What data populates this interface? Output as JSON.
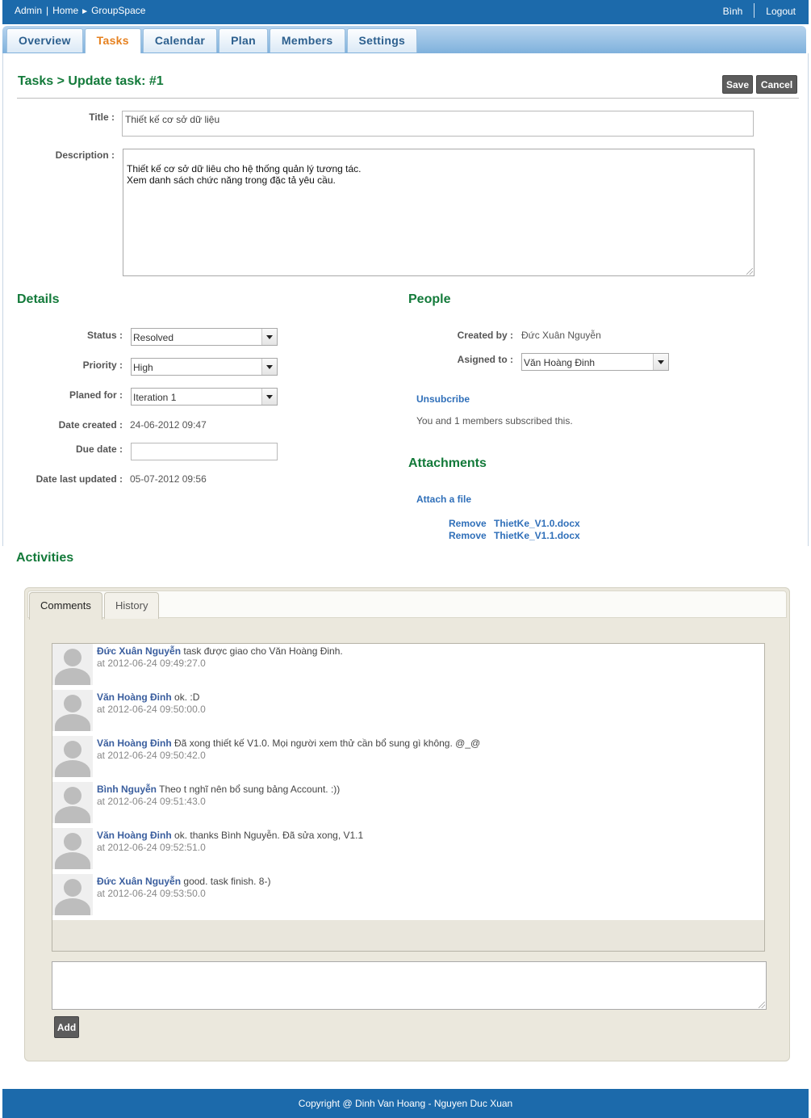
{
  "topbar": {
    "crumbs": [
      "Admin",
      "Home",
      "GroupSpace"
    ],
    "crumb_sep": "|",
    "crumb_arrow": "►",
    "user": "Bình",
    "logout": "Logout"
  },
  "tabs": [
    {
      "label": "Overview",
      "active": false
    },
    {
      "label": "Tasks",
      "active": true
    },
    {
      "label": "Calendar",
      "active": false
    },
    {
      "label": "Plan",
      "active": false
    },
    {
      "label": "Members",
      "active": false
    },
    {
      "label": "Settings",
      "active": false
    }
  ],
  "heading": "Tasks > Update task: #1",
  "buttons": {
    "save": "Save",
    "cancel": "Cancel",
    "add": "Add"
  },
  "form": {
    "title_label": "Title :",
    "title_value": "Thiết kế cơ sở dữ liệu",
    "description_label": "Description :",
    "description_value": "Thiết kế cơ sở dữ liêu cho hệ thống quản lý tương tác.\nXem danh sách chức năng trong đặc tả yêu cầu."
  },
  "details": {
    "section_title": "Details",
    "status_label": "Status :",
    "status_value": "Resolved",
    "priority_label": "Priority :",
    "priority_value": "High",
    "planed_label": "Planed for :",
    "planed_value": "Iteration 1",
    "created_label": "Date created :",
    "created_value": "24-06-2012 09:47",
    "due_label": "Due date :",
    "due_value": "",
    "updated_label": "Date last updated :",
    "updated_value": "05-07-2012 09:56"
  },
  "people": {
    "section_title": "People",
    "created_by_label": "Created by :",
    "created_by_value": "Đức Xuân Nguyễn",
    "assigned_label": "Asigned to :",
    "assigned_value": "Văn Hoàng Đinh",
    "unsubscribe": "Unsubcribe",
    "subscribed_text": "You and 1 members subscribed this."
  },
  "attachments": {
    "section_title": "Attachments",
    "attach_link": "Attach a file",
    "remove_label": "Remove",
    "files": [
      "ThietKe_V1.0.docx",
      "ThietKe_V1.1.docx"
    ]
  },
  "activities": {
    "section_title": "Activities",
    "tabs": [
      "Comments",
      "History"
    ],
    "comments": [
      {
        "author": "Đức Xuân Nguyễn",
        "text": "task được giao cho Văn Hoàng Đinh.",
        "time": "at 2012-06-24 09:49:27.0"
      },
      {
        "author": "Văn Hoàng Đinh",
        "text": "ok. :D",
        "time": "at 2012-06-24 09:50:00.0"
      },
      {
        "author": "Văn Hoàng Đinh",
        "text": "Đã xong thiết kế V1.0. Mọi người xem thử cần bổ sung gì không. @_@",
        "time": "at 2012-06-24 09:50:42.0"
      },
      {
        "author": "Bình Nguyễn",
        "text": "Theo t nghĩ nên bổ sung bảng Account. :))",
        "time": "at 2012-06-24 09:51:43.0"
      },
      {
        "author": "Văn Hoàng Đinh",
        "text": "ok. thanks Bình Nguyễn. Đã sửa xong, V1.1",
        "time": "at 2012-06-24 09:52:51.0"
      },
      {
        "author": "Đức Xuân Nguyễn",
        "text": "good. task finish. 8-)",
        "time": "at 2012-06-24 09:53:50.0"
      }
    ]
  },
  "footer": "Copyright @ Dinh Van Hoang - Nguyen Duc Xuan",
  "colors": {
    "brand_blue": "#1c6aab",
    "section_green": "#137a3a",
    "link_blue": "#2f6fb9",
    "active_tab": "#e6811f"
  }
}
